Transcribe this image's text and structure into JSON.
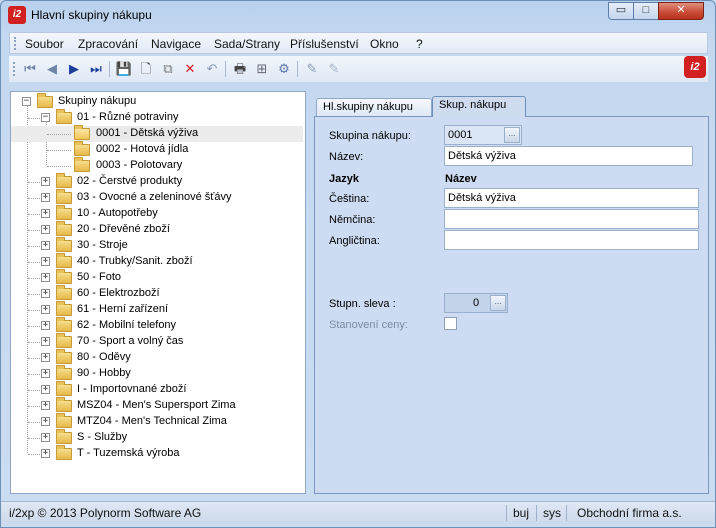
{
  "window": {
    "title": "Hlavní skupiny nákupu",
    "app_icon": "i2",
    "controls": {
      "minimize": "▭",
      "maximize": "□",
      "close": "✕"
    }
  },
  "menu": {
    "items": [
      "Soubor",
      "Zpracování",
      "Navigace",
      "Sada/Strany",
      "Příslušenství",
      "Okno",
      "?"
    ]
  },
  "toolbar": {
    "buttons": [
      {
        "name": "first-record-icon",
        "glyph": "⏮"
      },
      {
        "name": "prev-record-icon",
        "glyph": "◀"
      },
      {
        "name": "next-record-icon",
        "glyph": "▶"
      },
      {
        "name": "last-record-icon",
        "glyph": "⏭"
      },
      {
        "name": "save-icon",
        "glyph": "💾"
      },
      {
        "name": "new-icon",
        "glyph": "🗋"
      },
      {
        "name": "copy-icon",
        "glyph": "⧉"
      },
      {
        "name": "delete-icon",
        "glyph": "✕"
      },
      {
        "name": "undo-icon",
        "glyph": "↶"
      },
      {
        "name": "print-icon",
        "glyph": "🖶"
      },
      {
        "name": "hierarchy-icon",
        "glyph": "⊞"
      },
      {
        "name": "settings-icon",
        "glyph": "⚙"
      },
      {
        "name": "edit-icon",
        "glyph": "✎"
      },
      {
        "name": "edit-disabled-icon",
        "glyph": "✎"
      }
    ],
    "logo": "i2"
  },
  "tree": {
    "root": "Skupiny nákupu",
    "items": [
      {
        "label": "01  -  Různé potraviny",
        "level": 1,
        "expander": "−"
      },
      {
        "label": "0001  -  Dětská výživa",
        "level": 2,
        "selected": true,
        "open": true
      },
      {
        "label": "0002  -  Hotová jídla",
        "level": 2
      },
      {
        "label": "0003  -  Polotovary",
        "level": 2
      },
      {
        "label": "02  -  Čerstvé produkty",
        "level": 1,
        "expander": "+"
      },
      {
        "label": "03  -  Ovocné a zeleninové šťávy",
        "level": 1,
        "expander": "+"
      },
      {
        "label": "10  -  Autopotřeby",
        "level": 1,
        "expander": "+"
      },
      {
        "label": "20  -  Dřevěné zboží",
        "level": 1,
        "expander": "+"
      },
      {
        "label": "30  -  Stroje",
        "level": 1,
        "expander": "+"
      },
      {
        "label": "40  -  Trubky/Sanit. zboží",
        "level": 1,
        "expander": "+"
      },
      {
        "label": "50  -  Foto",
        "level": 1,
        "expander": "+"
      },
      {
        "label": "60  -  Elektrozboží",
        "level": 1,
        "expander": "+"
      },
      {
        "label": "61  -  Herní zařízení",
        "level": 1,
        "expander": "+"
      },
      {
        "label": "62  -  Mobilní telefony",
        "level": 1,
        "expander": "+"
      },
      {
        "label": "70  -  Sport a volný čas",
        "level": 1,
        "expander": "+"
      },
      {
        "label": "80  -  Oděvy",
        "level": 1,
        "expander": "+"
      },
      {
        "label": "90  -  Hobby",
        "level": 1,
        "expander": "+"
      },
      {
        "label": "I  -  Importovnané zboží",
        "level": 1,
        "expander": "+"
      },
      {
        "label": "MSZ04  -  Men's Supersport Zima",
        "level": 1,
        "expander": "+"
      },
      {
        "label": "MTZ04  -  Men's Technical Zima",
        "level": 1,
        "expander": "+"
      },
      {
        "label": "S  -  Služby",
        "level": 1,
        "expander": "+"
      },
      {
        "label": "T  -  Tuzemská výroba",
        "level": 1,
        "expander": "+"
      }
    ]
  },
  "tabs": [
    {
      "label": "Hl.skupiny nákupu"
    },
    {
      "label": "Skup. nákupu",
      "active": true
    }
  ],
  "form": {
    "group_label": "Skupina nákupu:",
    "group_value": "0001",
    "name_label": "Název:",
    "name_value": "Dětská výživa",
    "lang_header": "Jazyk",
    "name_header": "Název",
    "languages": [
      {
        "label": "Čeština:",
        "value": "Dětská výživa"
      },
      {
        "label": "Němčina:",
        "value": ""
      },
      {
        "label": "Angličtina:",
        "value": ""
      }
    ],
    "discount_label": "Stupn. sleva :",
    "discount_value": "0",
    "pricing_label": "Stanovení ceny:",
    "lookup_glyph": "..."
  },
  "status": {
    "copyright": "i/2xp © 2013 Polynorm Software AG",
    "mode": "buj",
    "user": "sys",
    "company": "Obchodní firma a.s."
  }
}
